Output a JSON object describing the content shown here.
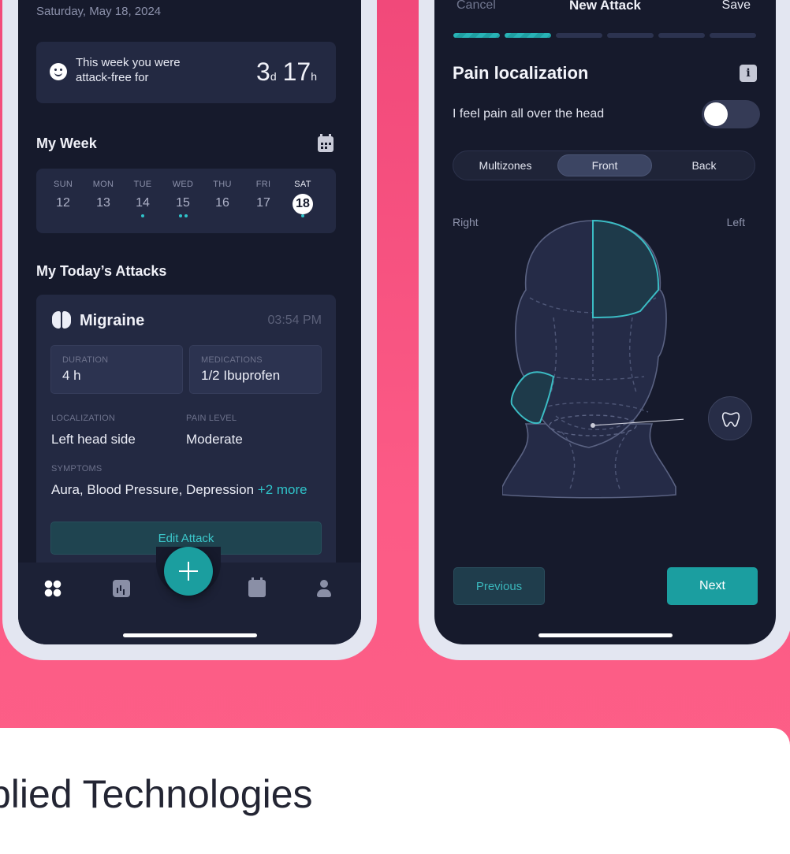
{
  "left_phone": {
    "date": "Saturday, May 18, 2024",
    "attack_free": {
      "text": "This week you were attack-free for",
      "days": "3",
      "days_unit": "d",
      "hours": "17",
      "hours_unit": "h"
    },
    "my_week": {
      "title": "My Week",
      "days": [
        {
          "name": "SUN",
          "date": "12",
          "dots": 0
        },
        {
          "name": "MON",
          "date": "13",
          "dots": 0
        },
        {
          "name": "TUE",
          "date": "14",
          "dots": 1
        },
        {
          "name": "WED",
          "date": "15",
          "dots": 2
        },
        {
          "name": "THU",
          "date": "16",
          "dots": 0
        },
        {
          "name": "FRI",
          "date": "17",
          "dots": 0
        },
        {
          "name": "SAT",
          "date": "18",
          "dots": 1,
          "today": true
        }
      ]
    },
    "today_attacks": {
      "title": "My Today’s Attacks",
      "attack": {
        "name": "Migraine",
        "time": "03:54 PM",
        "duration_label": "DURATION",
        "duration": "4 h",
        "medications_label": "MEDICATIONS",
        "medications": "1/2 Ibuprofen",
        "localization_label": "LOCALIZATION",
        "localization": "Left head side",
        "pain_level_label": "PAIN LEVEL",
        "pain_level": "Moderate",
        "symptoms_label": "SYMPTOMS",
        "symptoms": "Aura, Blood Pressure, Depression",
        "symptoms_more": "+2 more",
        "edit_label": "Edit Attack"
      }
    }
  },
  "right_phone": {
    "nav": {
      "cancel": "Cancel",
      "title": "New Attack",
      "save": "Save"
    },
    "progress": {
      "total_steps": 6,
      "completed_steps": 2
    },
    "section_title": "Pain localization",
    "info_icon": "i",
    "toggle": {
      "label": "I feel pain all over the head",
      "on": false
    },
    "tabs": [
      "Multizones",
      "Front",
      "Back"
    ],
    "active_tab": "Front",
    "side_right": "Right",
    "side_left": "Left",
    "buttons": {
      "previous": "Previous",
      "next": "Next"
    }
  },
  "bottom": {
    "heading": "plied Technologies"
  },
  "colors": {
    "background": "#fd5f87",
    "screen": "#161a2c",
    "card": "#232942",
    "accent": "#2fc3c9",
    "primary_button": "#1b9ea0"
  }
}
